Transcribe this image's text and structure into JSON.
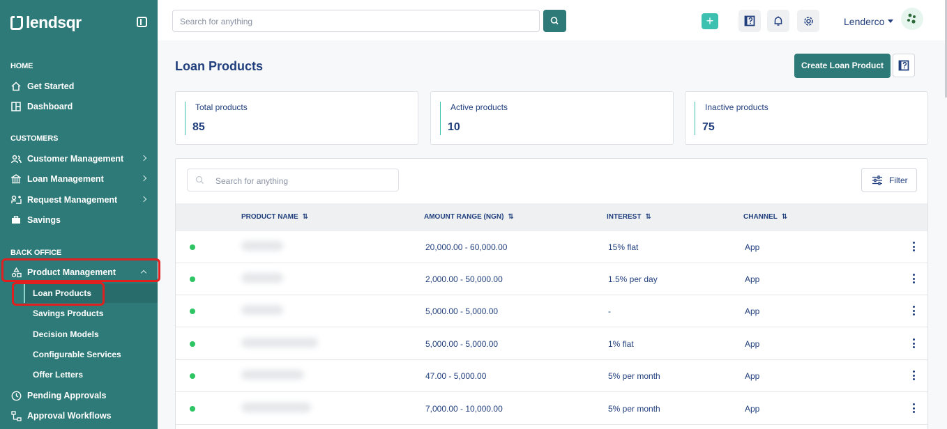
{
  "brand": {
    "logo_text": "lendsqr"
  },
  "sidebar": {
    "sections": {
      "home": "HOME",
      "customers": "CUSTOMERS",
      "back_office": "BACK OFFICE"
    },
    "items": {
      "get_started": "Get Started",
      "dashboard": "Dashboard",
      "customer_management": "Customer Management",
      "loan_management": "Loan Management",
      "request_management": "Request Management",
      "savings": "Savings",
      "product_management": "Product Management",
      "pending_approvals": "Pending Approvals",
      "approval_workflows": "Approval Workflows"
    },
    "product_sub": [
      "Loan Products",
      "Savings Products",
      "Decision Models",
      "Configurable Services",
      "Offer Letters"
    ]
  },
  "topbar": {
    "search_placeholder": "Search for anything",
    "plus_label": "+",
    "user_name": "Lenderco"
  },
  "main": {
    "title": "Loan Products",
    "create_button": "Create Loan Product",
    "stats": [
      {
        "label": "Total products",
        "value": "85"
      },
      {
        "label": "Active products",
        "value": "10"
      },
      {
        "label": "Inactive products",
        "value": "75"
      }
    ],
    "table": {
      "search_placeholder": "Search for anything",
      "filter_label": "Filter",
      "headers": [
        "PRODUCT NAME",
        "AMOUNT RANGE (NGN)",
        "INTEREST",
        "CHANNEL"
      ],
      "rows": [
        {
          "amount": "20,000.00 - 60,000.00",
          "interest": "15% flat",
          "channel": "App"
        },
        {
          "amount": "2,000.00 - 50,000.00",
          "interest": "1.5% per day",
          "channel": "App"
        },
        {
          "amount": "5,000.00 - 5,000.00",
          "interest": "-",
          "channel": "App"
        },
        {
          "amount": "5,000.00 - 5,000.00",
          "interest": "1% flat",
          "channel": "App"
        },
        {
          "amount": "47.00 - 5,000.00",
          "interest": "5% per month",
          "channel": "App"
        },
        {
          "amount": "7,000.00 - 10,000.00",
          "interest": "5% per month",
          "channel": "App"
        }
      ]
    }
  },
  "colors": {
    "brand": "#2e7a78",
    "accent": "#3cc0b0",
    "text": "#213f7d",
    "status_active": "#2ec463",
    "highlight": "#e01f1f"
  }
}
